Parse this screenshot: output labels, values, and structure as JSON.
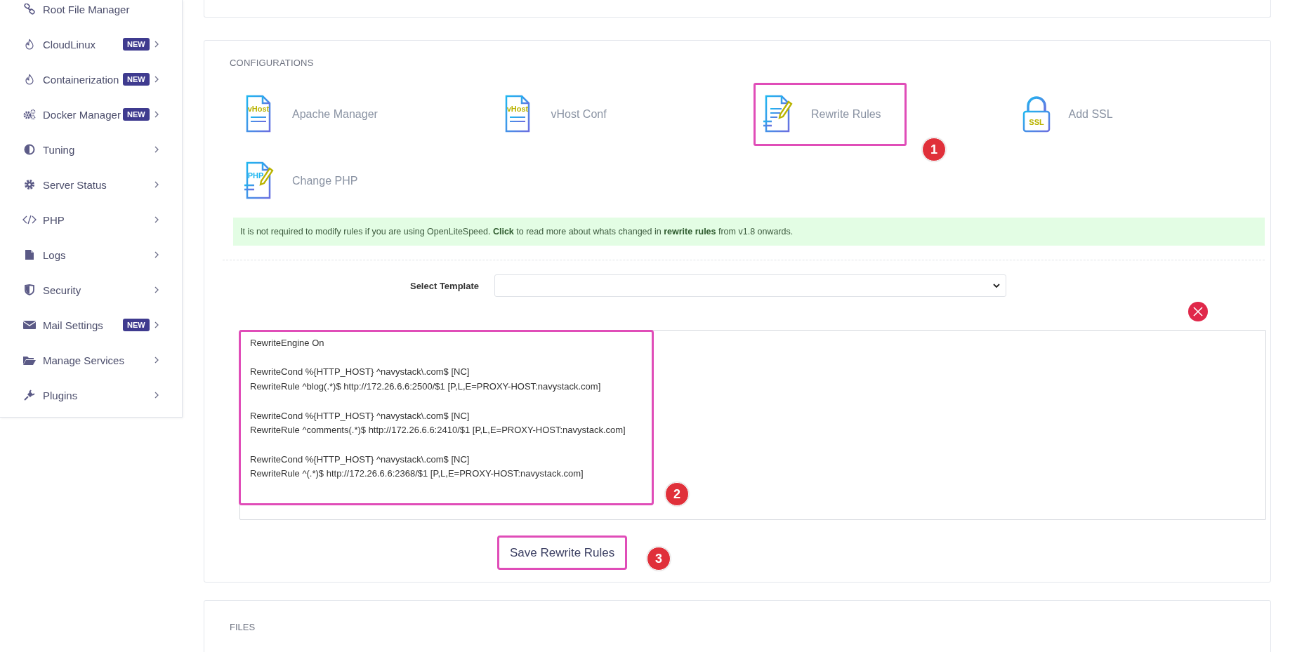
{
  "sidebar": {
    "items": [
      {
        "label": "Root File Manager",
        "expandable": false
      },
      {
        "label": "CloudLinux",
        "badge": "NEW",
        "expandable": true
      },
      {
        "label": "Containerization",
        "badge": "NEW",
        "expandable": true
      },
      {
        "label": "Docker Manager",
        "badge": "NEW",
        "expandable": true
      },
      {
        "label": "Tuning",
        "expandable": true
      },
      {
        "label": "Server Status",
        "expandable": true
      },
      {
        "label": "PHP",
        "expandable": true
      },
      {
        "label": "Logs",
        "expandable": true
      },
      {
        "label": "Security",
        "expandable": true
      },
      {
        "label": "Mail Settings",
        "badge": "NEW",
        "expandable": true
      },
      {
        "label": "Manage Services",
        "expandable": true
      },
      {
        "label": "Plugins",
        "expandable": true
      }
    ]
  },
  "configurations": {
    "title": "CONFIGURATIONS",
    "items": [
      {
        "label": "Apache Manager",
        "icon_text": "vHost",
        "highlighted": false
      },
      {
        "label": "vHost Conf",
        "icon_text": "vHost",
        "highlighted": false
      },
      {
        "label": "Rewrite Rules",
        "highlighted": true,
        "marker": "1"
      },
      {
        "label": "Add SSL",
        "icon_text": "SSL",
        "highlighted": false
      },
      {
        "label": "Change PHP",
        "icon_text": "PHP",
        "highlighted": false
      }
    ],
    "notice": "It is not required to modify rules if you are using OpenLiteSpeed. **Click** to read more about whats changed in **rewrite rules** from v1.8 onwards.",
    "template_label": "Select Template",
    "rules_text": "RewriteEngine On\n\nRewriteCond %{HTTP_HOST} ^navystack\\.com$ [NC]\nRewriteRule ^blog(.*)$ http://172.26.6.6:2500/$1 [P,L,E=PROXY-HOST:navystack.com]\n\nRewriteCond %{HTTP_HOST} ^navystack\\.com$ [NC]\nRewriteRule ^comments(.*)$ http://172.26.6.6:2410/$1 [P,L,E=PROXY-HOST:navystack.com]\n\nRewriteCond %{HTTP_HOST} ^navystack\\.com$ [NC]\nRewriteRule ^(.*)$ http://172.26.6.6:2368/$1 [P,L,E=PROXY-HOST:navystack.com]",
    "rules_marker": "2",
    "save_button": {
      "label": "Save Rewrite Rules",
      "highlighted": true,
      "marker": "3"
    }
  },
  "files": {
    "title": "FILES"
  }
}
